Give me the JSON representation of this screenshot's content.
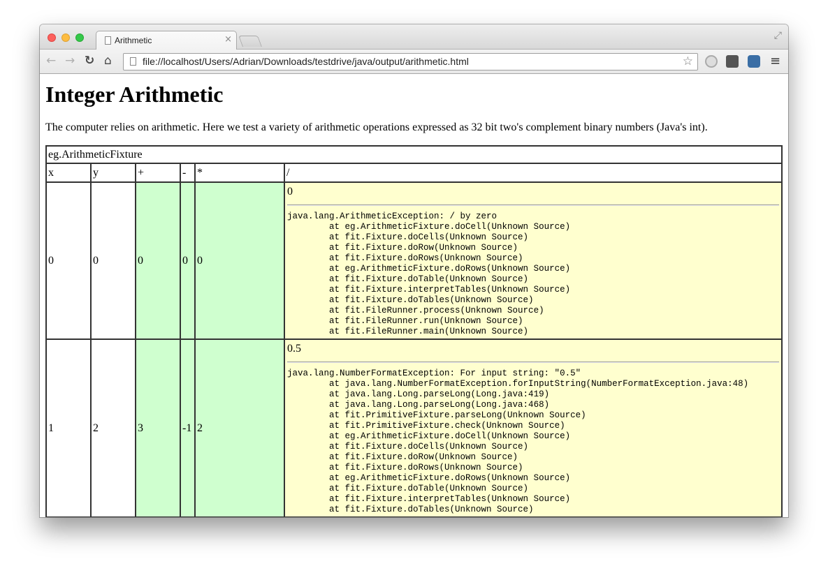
{
  "browser": {
    "tab_title": "Arithmetic",
    "tab_close": "×",
    "url": "file://localhost/Users/Adrian/Downloads/testdrive/java/output/arithmetic.html",
    "nav": {
      "back": "←",
      "forward": "→",
      "reload": "↻",
      "home": "⌂",
      "star": "☆",
      "menu": "≡",
      "resize": "⤢"
    }
  },
  "page": {
    "heading": "Integer Arithmetic",
    "intro": "The computer relies on arithmetic. Here we test a variety of arithmetic operations expressed as 32 bit two's complement binary numbers (Java's int).",
    "table": {
      "fixture_name": "eg.ArithmeticFixture",
      "headers": [
        "x",
        "y",
        "+",
        "-",
        "*",
        "/"
      ],
      "rows": [
        {
          "x": "0",
          "y": "0",
          "plus": "0",
          "minus": "0",
          "times": "0",
          "divide_value": "0",
          "divide_trace": "java.lang.ArithmeticException: / by zero\n\tat eg.ArithmeticFixture.doCell(Unknown Source)\n\tat fit.Fixture.doCells(Unknown Source)\n\tat fit.Fixture.doRow(Unknown Source)\n\tat fit.Fixture.doRows(Unknown Source)\n\tat eg.ArithmeticFixture.doRows(Unknown Source)\n\tat fit.Fixture.doTable(Unknown Source)\n\tat fit.Fixture.interpretTables(Unknown Source)\n\tat fit.Fixture.doTables(Unknown Source)\n\tat fit.FileRunner.process(Unknown Source)\n\tat fit.FileRunner.run(Unknown Source)\n\tat fit.FileRunner.main(Unknown Source)"
        },
        {
          "x": "1",
          "y": "2",
          "plus": "3",
          "minus": "-1",
          "times": "2",
          "divide_value": "0.5",
          "divide_trace": "java.lang.NumberFormatException: For input string: \"0.5\"\n\tat java.lang.NumberFormatException.forInputString(NumberFormatException.java:48)\n\tat java.lang.Long.parseLong(Long.java:419)\n\tat java.lang.Long.parseLong(Long.java:468)\n\tat fit.PrimitiveFixture.parseLong(Unknown Source)\n\tat fit.PrimitiveFixture.check(Unknown Source)\n\tat eg.ArithmeticFixture.doCell(Unknown Source)\n\tat fit.Fixture.doCells(Unknown Source)\n\tat fit.Fixture.doRow(Unknown Source)\n\tat fit.Fixture.doRows(Unknown Source)\n\tat eg.ArithmeticFixture.doRows(Unknown Source)\n\tat fit.Fixture.doTable(Unknown Source)\n\tat fit.Fixture.interpretTables(Unknown Source)\n\tat fit.Fixture.doTables(Unknown Source)"
        }
      ]
    }
  },
  "colors": {
    "pass": "#cfffcf",
    "fail": "#ffffcf"
  }
}
